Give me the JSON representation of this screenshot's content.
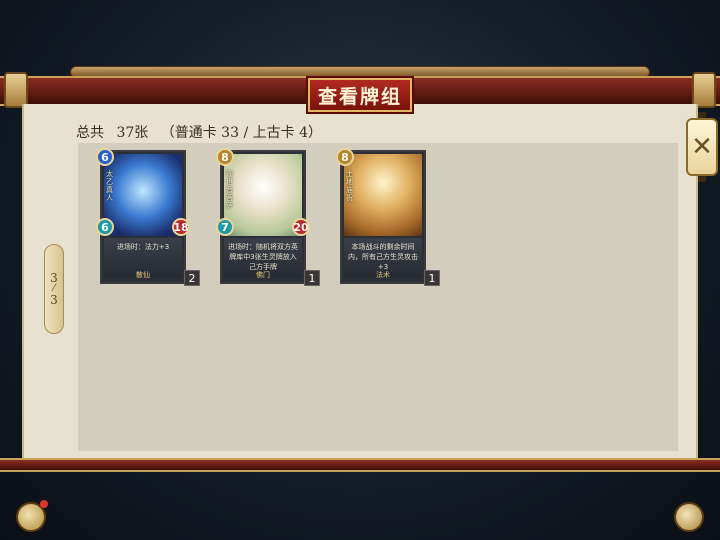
{
  "title": "查看牌组",
  "summary": {
    "total_label": "总共",
    "total_count": "37张",
    "breakdown": "（普通卡 33 / 上古卡 4）"
  },
  "pager": {
    "current": "3",
    "total": "3"
  },
  "close_icon": "close-icon",
  "cards": [
    {
      "name": "太乙真人",
      "cost": "6",
      "attack": "6",
      "health": "18",
      "text": "进场时：法力+3",
      "type": "散仙",
      "count": "2"
    },
    {
      "name": "观世音菩萨",
      "cost": "8",
      "attack": "7",
      "health": "20",
      "text": "进场时：随机将双方英牌库中3张生灵牌放入己方手牌",
      "type": "佛门",
      "count": "1"
    },
    {
      "name": "土地庙祝",
      "cost": "8",
      "attack": "",
      "health": "",
      "text": "本场战斗的剩余时间内，所有己方生灵攻击+3",
      "type": "法术",
      "count": "1"
    }
  ],
  "colors": {
    "frame_red": "#7a120c",
    "paper": "#e7e1cf",
    "deck_bg": "#d3cdbd",
    "gold_trim": "#e0b860"
  },
  "icons": {
    "chat": "chat-icon",
    "bag": "bag-icon"
  }
}
